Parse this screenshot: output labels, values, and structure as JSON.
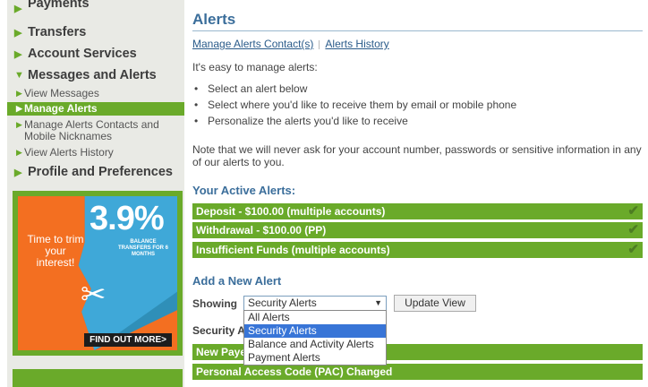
{
  "sidebar": {
    "items": [
      {
        "label": "Payments",
        "type": "main",
        "expanded": false
      },
      {
        "label": "Transfers",
        "type": "main",
        "expanded": false
      },
      {
        "label": "Account Services",
        "type": "main",
        "expanded": false
      },
      {
        "label": "Messages and Alerts",
        "type": "main",
        "expanded": true
      },
      {
        "label": "View Messages",
        "type": "sub",
        "active": false
      },
      {
        "label": "Manage Alerts",
        "type": "sub",
        "active": true
      },
      {
        "label": "Manage Alerts Contacts and Mobile Nicknames",
        "type": "sub",
        "active": false
      },
      {
        "label": "View Alerts History",
        "type": "sub",
        "active": false
      },
      {
        "label": "Profile and Preferences",
        "type": "main",
        "expanded": false
      }
    ]
  },
  "promo": {
    "headline": "Time to trim your interest!",
    "rate": "3.9%",
    "subtext": "BALANCE TRANSFERS FOR 6 MONTHS",
    "cta": "FIND OUT MORE>"
  },
  "main": {
    "title": "Alerts",
    "links": [
      "Manage Alerts Contact(s)",
      "Alerts History"
    ],
    "intro": "It's easy to manage alerts:",
    "bullets": [
      "Select an alert below",
      "Select where you'd like to receive them by email or mobile phone",
      "Personalize the alerts you'd like to receive"
    ],
    "note": "Note that we will never ask for your account number, passwords or sensitive information in any of our alerts to you.",
    "active_alerts_heading": "Your Active Alerts:",
    "active_alerts": [
      "Deposit - $100.00 (multiple accounts)",
      "Withdrawal - $100.00 (PP)",
      "Insufficient Funds (multiple accounts)"
    ],
    "add_alert_heading": "Add a New Alert",
    "showing_label": "Showing",
    "select_value": "Security Alerts",
    "update_button": "Update View",
    "dropdown_options": [
      "All Alerts",
      "Security Alerts",
      "Balance and Activity Alerts",
      "Payment Alerts"
    ],
    "security_heading": "Security A",
    "security_alerts": [
      "New Paye",
      "Personal Access Code (PAC) Changed"
    ]
  },
  "colors": {
    "accent_green": "#6aaa2a",
    "title_blue": "#3b6e9b",
    "link_blue": "#2a5b8a",
    "dropdown_highlight": "#3875d7"
  }
}
